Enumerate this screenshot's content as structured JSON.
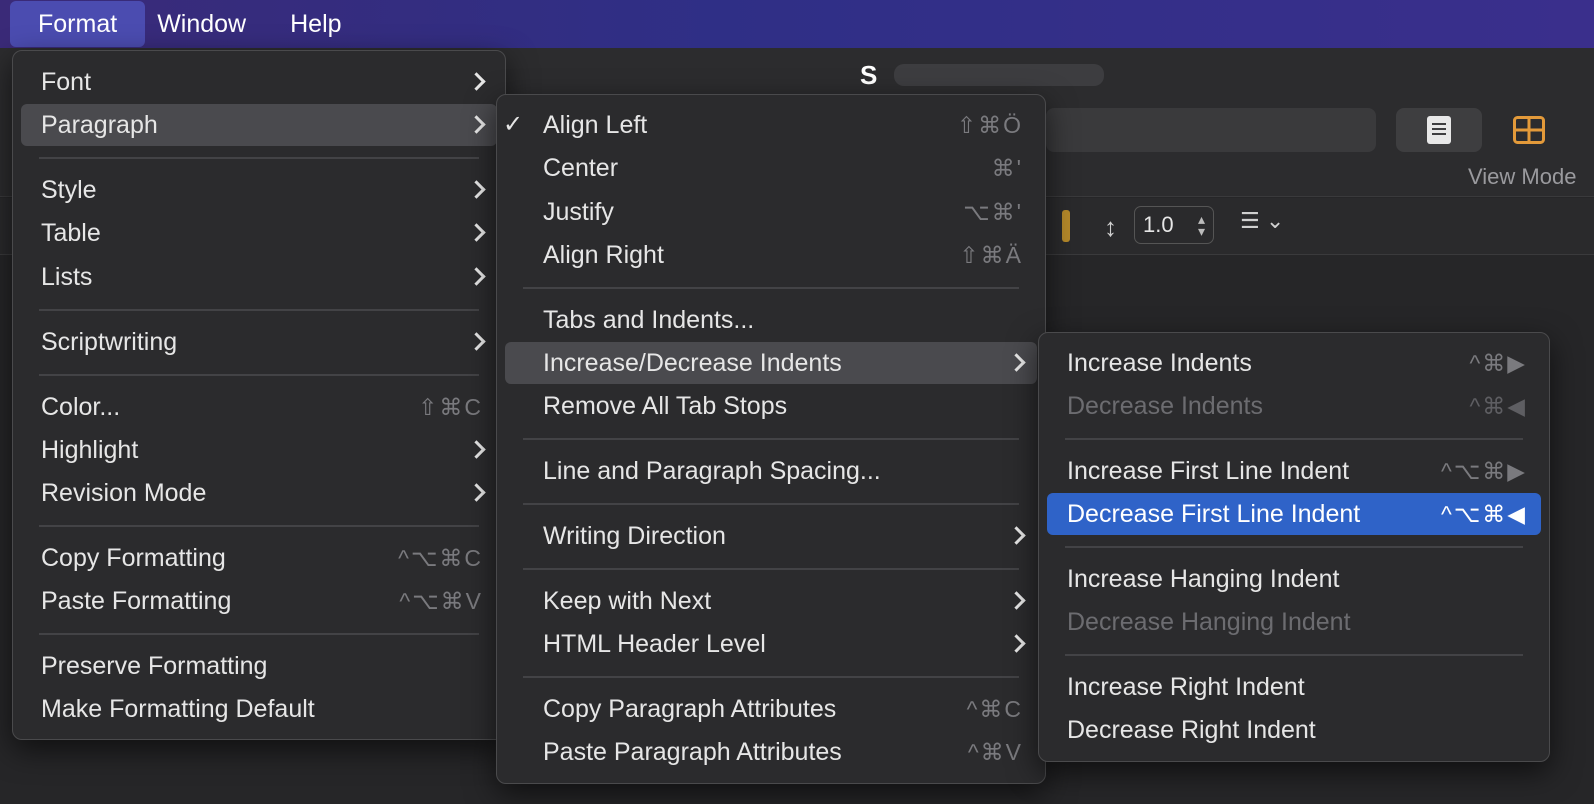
{
  "menubar": {
    "format": "Format",
    "window": "Window",
    "help": "Help"
  },
  "toolbar": {
    "view_mode": "View Mode",
    "line_height": "1.0"
  },
  "format_menu": {
    "font": "Font",
    "paragraph": "Paragraph",
    "style": "Style",
    "table": "Table",
    "lists": "Lists",
    "scriptwriting": "Scriptwriting",
    "color": "Color...",
    "color_shortcut": "⇧⌘C",
    "highlight": "Highlight",
    "revision_mode": "Revision Mode",
    "copy_formatting": "Copy Formatting",
    "copy_formatting_shortcut": "^⌥⌘C",
    "paste_formatting": "Paste Formatting",
    "paste_formatting_shortcut": "^⌥⌘V",
    "preserve_formatting": "Preserve Formatting",
    "make_default": "Make Formatting Default"
  },
  "paragraph_menu": {
    "align_left": "Align Left",
    "align_left_shortcut": "⇧⌘Ö",
    "center": "Center",
    "center_shortcut": "⌘'",
    "justify": "Justify",
    "justify_shortcut": "⌥⌘'",
    "align_right": "Align Right",
    "align_right_shortcut": "⇧⌘Ä",
    "tabs_indents": "Tabs and Indents...",
    "inc_dec_indents": "Increase/Decrease Indents",
    "remove_tab_stops": "Remove All Tab Stops",
    "line_spacing": "Line and Paragraph Spacing...",
    "writing_direction": "Writing Direction",
    "keep_with_next": "Keep with Next",
    "html_header_level": "HTML Header Level",
    "copy_para_attrs": "Copy Paragraph Attributes",
    "copy_para_attrs_shortcut": "^⌘C",
    "paste_para_attrs": "Paste Paragraph Attributes",
    "paste_para_attrs_shortcut": "^⌘V"
  },
  "indents_menu": {
    "increase_indents": "Increase Indents",
    "increase_indents_shortcut": "^⌘▶",
    "decrease_indents": "Decrease Indents",
    "decrease_indents_shortcut": "^⌘◀",
    "increase_first": "Increase First Line Indent",
    "increase_first_shortcut": "^⌥⌘▶",
    "decrease_first": "Decrease First Line Indent",
    "decrease_first_shortcut": "^⌥⌘◀",
    "increase_hanging": "Increase Hanging Indent",
    "decrease_hanging": "Decrease Hanging Indent",
    "increase_right": "Increase Right Indent",
    "decrease_right": "Decrease Right Indent"
  }
}
